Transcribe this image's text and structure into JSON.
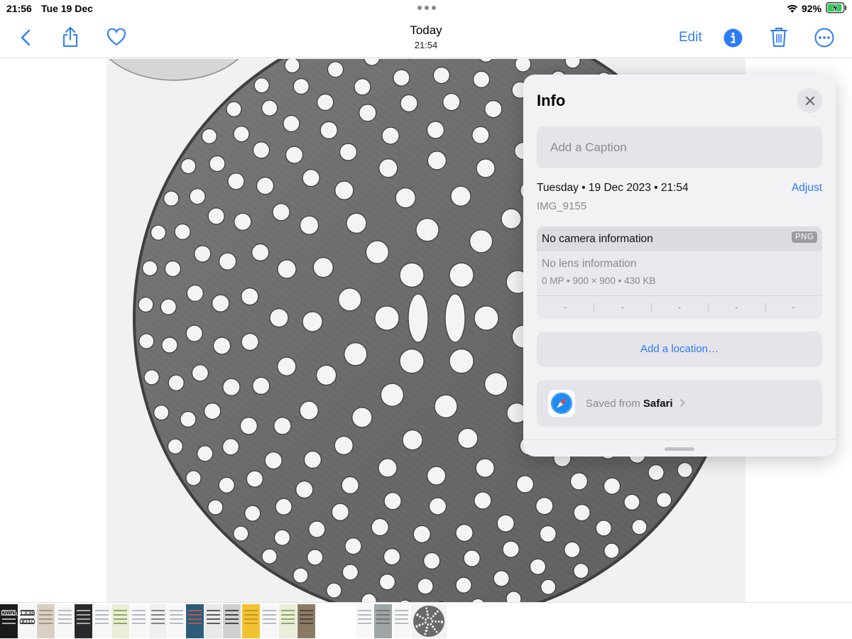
{
  "status_bar": {
    "time": "21:56",
    "date": "Tue 19 Dec",
    "battery_percent": "92%",
    "battery_level": 0.92,
    "charging": true
  },
  "nav": {
    "title": "Today",
    "subtitle": "21:54",
    "edit_label": "Edit",
    "accent_color": "#2d7cf6"
  },
  "info_panel": {
    "heading": "Info",
    "caption_placeholder": "Add a Caption",
    "date_line": "Tuesday • 19 Dec 2023 • 21:54",
    "adjust_label": "Adjust",
    "filename": "IMG_9155",
    "camera": {
      "title": "No camera information",
      "format_badge": "PNG",
      "lens": "No lens information",
      "specs": "0 MP  •  900 × 900  •  430 KB",
      "exif": [
        "-",
        "-",
        "-",
        "-",
        "-"
      ]
    },
    "location_label": "Add a location…",
    "saved_from_prefix": "Saved from",
    "saved_from_app": "Safari"
  },
  "thumbnail_strip": {
    "thumbs": [
      {
        "kind": "dark-text",
        "text": "Produ"
      },
      {
        "kind": "barcode",
        "text": "1338\n0010"
      },
      {
        "kind": "beige"
      },
      {
        "kind": "document"
      },
      {
        "kind": "dark-screen"
      },
      {
        "kind": "document"
      },
      {
        "kind": "green-doc"
      },
      {
        "kind": "document"
      },
      {
        "kind": "clock"
      },
      {
        "kind": "document"
      },
      {
        "kind": "infographic"
      },
      {
        "kind": "gamepad"
      },
      {
        "kind": "gamepad-dark"
      },
      {
        "kind": "yellow"
      },
      {
        "kind": "document"
      },
      {
        "kind": "green-doc"
      },
      {
        "kind": "device"
      },
      {
        "kind": "blank"
      },
      {
        "kind": "document"
      },
      {
        "kind": "photo-grey"
      },
      {
        "kind": "document"
      },
      {
        "kind": "sieve-selected"
      }
    ]
  }
}
